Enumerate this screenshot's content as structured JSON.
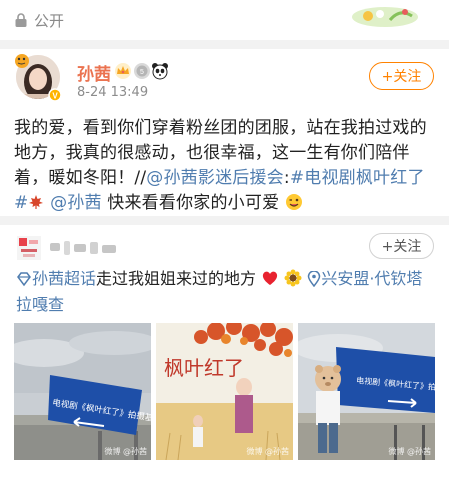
{
  "topbar": {
    "visibility": "公开",
    "lock_icon": "lock-icon",
    "decor_icon": "decoration-badge-icon"
  },
  "post": {
    "author": "孙茜",
    "time": "8-24 13:49",
    "follow_label": "+关注",
    "text_1": "我的爱，看到你们穿着粉丝团的团服，站在我拍过戏的地方，我真的很感动，也很幸福，这一生有你们陪伴着，暖如冬阳！",
    "text_sep": "//",
    "mention_fanclub": "@孙茜影迷后援会",
    "text_colon": ":",
    "hashtag": "#电视剧枫叶红了#",
    "mention_self": "@孙茜",
    "text_2": " 快来看看你家的小可爱",
    "icons": [
      "crown-icon",
      "member-badge-icon",
      "panda-icon",
      "maple-leaf-icon",
      "wink-face-icon"
    ]
  },
  "repost": {
    "follow_label": "+关注",
    "supertopic": "孙茜超话",
    "text": "走过我姐姐来过的地方",
    "location": "兴安盟·代钦塔拉嘎查",
    "icons": [
      "supertopic-diamond-icon",
      "heart-icon",
      "sunflower-icon",
      "location-pin-icon"
    ],
    "photos": [
      {
        "sign_text": "电视剧《枫叶红了》拍摄基地",
        "watermark": "微博 @孙茜"
      },
      {
        "poster_title": "枫叶红了",
        "watermark": "微博 @孙茜"
      },
      {
        "sign_text": "电视剧《枫叶红了》拍摄基地",
        "watermark": "微博 @孙茜"
      }
    ]
  },
  "colors": {
    "accent_orange": "#ff8200",
    "name_orange": "#eb7350",
    "link_blue": "#507daf"
  }
}
